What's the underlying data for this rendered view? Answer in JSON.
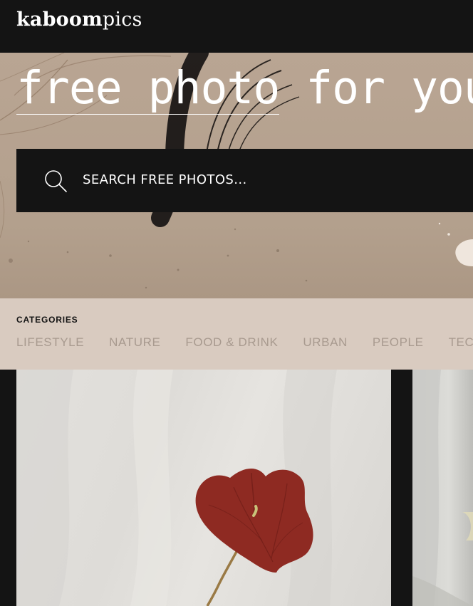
{
  "header": {
    "logo_bold": "kaboom",
    "logo_light": "pics"
  },
  "hero": {
    "title_underlined": "free photo",
    "title_rest": " for you",
    "search_placeholder": "SEARCH FREE PHOTOS..."
  },
  "categories": {
    "heading": "CATEGORIES",
    "items": [
      {
        "label": "LIFESTYLE"
      },
      {
        "label": "NATURE"
      },
      {
        "label": "FOOD & DRINK"
      },
      {
        "label": "URBAN"
      },
      {
        "label": "PEOPLE"
      },
      {
        "label": "TECHN"
      }
    ]
  },
  "colors": {
    "dark": "#141414",
    "hero_bg": "#b3a08d",
    "categories_bg": "#d9cbc0",
    "category_text": "#a89a8f",
    "flower": "#8e2a22"
  },
  "icons": {
    "search": "search-icon"
  }
}
